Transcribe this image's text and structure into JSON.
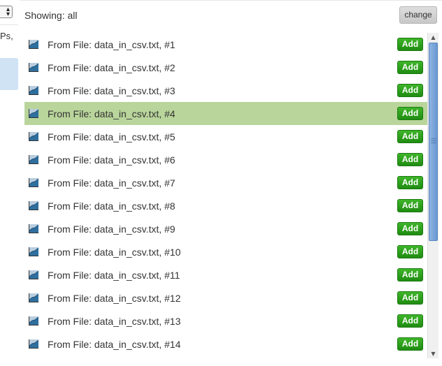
{
  "left_panel": {
    "select_icon": "up-down-arrows",
    "partial_text": "Ps,"
  },
  "header": {
    "showing_text": "Showing: all",
    "change_label": "change"
  },
  "list": {
    "icon": "line-chart-icon",
    "add_label": "Add",
    "selected_index": 3,
    "items": [
      {
        "label": "From File: data_in_csv.txt, #1"
      },
      {
        "label": "From File: data_in_csv.txt, #2"
      },
      {
        "label": "From File: data_in_csv.txt, #3"
      },
      {
        "label": "From File: data_in_csv.txt, #4"
      },
      {
        "label": "From File: data_in_csv.txt, #5"
      },
      {
        "label": "From File: data_in_csv.txt, #6"
      },
      {
        "label": "From File: data_in_csv.txt, #7"
      },
      {
        "label": "From File: data_in_csv.txt, #8"
      },
      {
        "label": "From File: data_in_csv.txt, #9"
      },
      {
        "label": "From File: data_in_csv.txt, #10"
      },
      {
        "label": "From File: data_in_csv.txt, #11"
      },
      {
        "label": "From File: data_in_csv.txt, #12"
      },
      {
        "label": "From File: data_in_csv.txt, #13"
      },
      {
        "label": "From File: data_in_csv.txt, #14"
      }
    ]
  },
  "colors": {
    "selected_row": "#b9d59b",
    "add_button": "#2a9d1c",
    "scroll_thumb": "#7aa5d8"
  }
}
